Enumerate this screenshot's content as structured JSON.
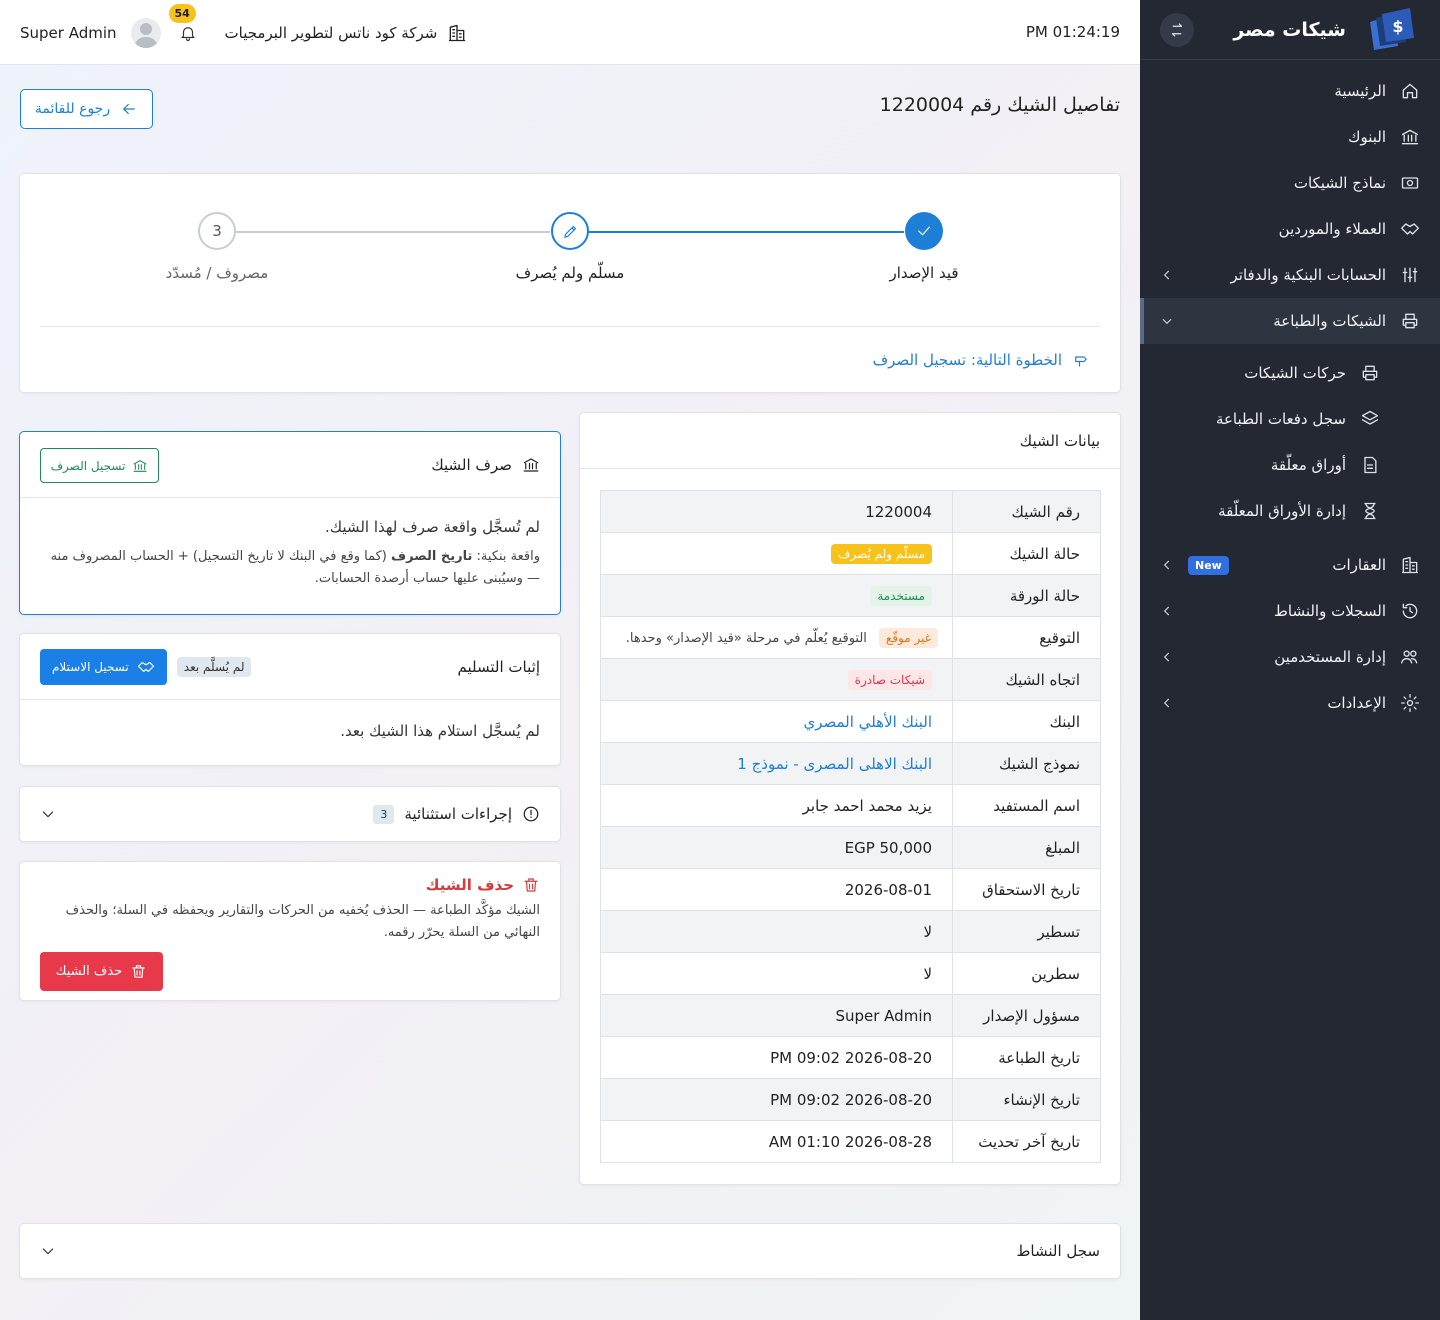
{
  "app": {
    "title": "شيكات مصر"
  },
  "sidebar": {
    "items": [
      {
        "label": "الرئيسية",
        "icon": "home-icon"
      },
      {
        "label": "البنوك",
        "icon": "bank-icon"
      },
      {
        "label": "نماذج الشيكات",
        "icon": "money-icon"
      },
      {
        "label": "العملاء والموردين",
        "icon": "handshake-icon"
      },
      {
        "label": "الحسابات البنكية والدفاتر",
        "icon": "sliders-icon"
      },
      {
        "label": "الشيكات والطباعة",
        "icon": "printer-icon"
      }
    ],
    "sub_items": [
      {
        "label": "حركات الشيكات",
        "icon": "printer-icon"
      },
      {
        "label": "سجل دفعات الطباعة",
        "icon": "layers-icon"
      },
      {
        "label": "أوراق معلّقة",
        "icon": "document-icon"
      },
      {
        "label": "إدارة الأوراق المعلّقة",
        "icon": "hourglass-icon"
      }
    ],
    "items2": [
      {
        "label": "العقارات",
        "icon": "building-icon",
        "badge": "New"
      },
      {
        "label": "السجلات والنشاط",
        "icon": "history-icon"
      },
      {
        "label": "إدارة المستخدمين",
        "icon": "users-icon"
      },
      {
        "label": "الإعدادات",
        "icon": "gear-icon"
      }
    ]
  },
  "topbar": {
    "clock": "PM 01:24:19",
    "company": "شركة كود ناتس لتطوير البرمجيات",
    "notifications": "54",
    "user": "Super Admin"
  },
  "page": {
    "title": "تفاصيل الشيك رقم 1220004",
    "back_label": "رجوع للقائمة"
  },
  "stepper": {
    "steps": [
      {
        "label": "قيد الإصدار",
        "state": "done"
      },
      {
        "label": "مسلّم ولم يُصرف",
        "state": "current"
      },
      {
        "label": "مصروف / مُسدّد",
        "state": "pending",
        "number": "3"
      }
    ],
    "next_step": "الخطوة التالية: تسجيل الصرف"
  },
  "info": {
    "title": "بيانات الشيك",
    "rows": [
      {
        "key": "رقم الشيك",
        "value": "1220004"
      },
      {
        "key": "حالة الشيك",
        "badge": "مسلّم ولم يُصرف"
      },
      {
        "key": "حالة الورقة",
        "badge": "مستخدمة"
      },
      {
        "key": "التوقيع",
        "badge": "غير موقّع",
        "note": "التوقيع يُعلّم في مرحلة «قيد الإصدار» وحدها."
      },
      {
        "key": "اتجاه الشيك",
        "badge": "شيكات صادرة"
      },
      {
        "key": "البنك",
        "link": "البنك الأهلي المصري"
      },
      {
        "key": "نموذج الشيك",
        "link": "البنك الاهلى المصرى - نموذج 1"
      },
      {
        "key": "اسم المستفيد",
        "value": "يزيد محمد احمد جابر"
      },
      {
        "key": "المبلغ",
        "value": "EGP 50,000"
      },
      {
        "key": "تاريخ الاستحقاق",
        "value": "2026-08-01"
      },
      {
        "key": "تسطير",
        "value": "لا"
      },
      {
        "key": "سطرين",
        "value": "لا"
      },
      {
        "key": "مسؤول الإصدار",
        "value": "Super Admin"
      },
      {
        "key": "تاريخ الطباعة",
        "value": "PM 09:02 2026-08-20"
      },
      {
        "key": "تاريخ الإنشاء",
        "value": "PM 09:02 2026-08-20"
      },
      {
        "key": "تاريخ آخر تحديث",
        "value": "AM 01:10 2026-08-28"
      }
    ]
  },
  "cash": {
    "title": "صرف الشيك",
    "button": "تسجيل الصرف",
    "empty": "لم تُسجَّل واقعة صرف لهذا الشيك.",
    "hint_prefix": "واقعة بنكية:",
    "hint_bold": "تاريخ الصرف",
    "hint_rest": "(كما وقع في البنك لا تاريخ التسجيل) + الحساب المصروف منه — وسيُبنى عليها حساب أرصدة الحسابات."
  },
  "delivery": {
    "title": "إثبات التسليم",
    "status": "لم يُسلَّم بعد",
    "button": "تسجيل الاستلام",
    "empty": "لم يُسجَّل استلام هذا الشيك بعد."
  },
  "exceptional": {
    "title": "إجراءات استثنائية",
    "count": "3"
  },
  "delete": {
    "title": "حذف الشيك",
    "text": "الشيك مؤكَّد الطباعة — الحذف يُخفيه من الحركات والتقارير ويحفظه في السلة؛ والحذف النهائي من السلة يحرّر رقمه.",
    "button": "حذف الشيك"
  },
  "activity": {
    "title": "سجل النشاط"
  },
  "colors": {
    "primary": "#1d7fd8",
    "sidebar": "#232833",
    "danger": "#e8394a",
    "success": "#20895a"
  }
}
